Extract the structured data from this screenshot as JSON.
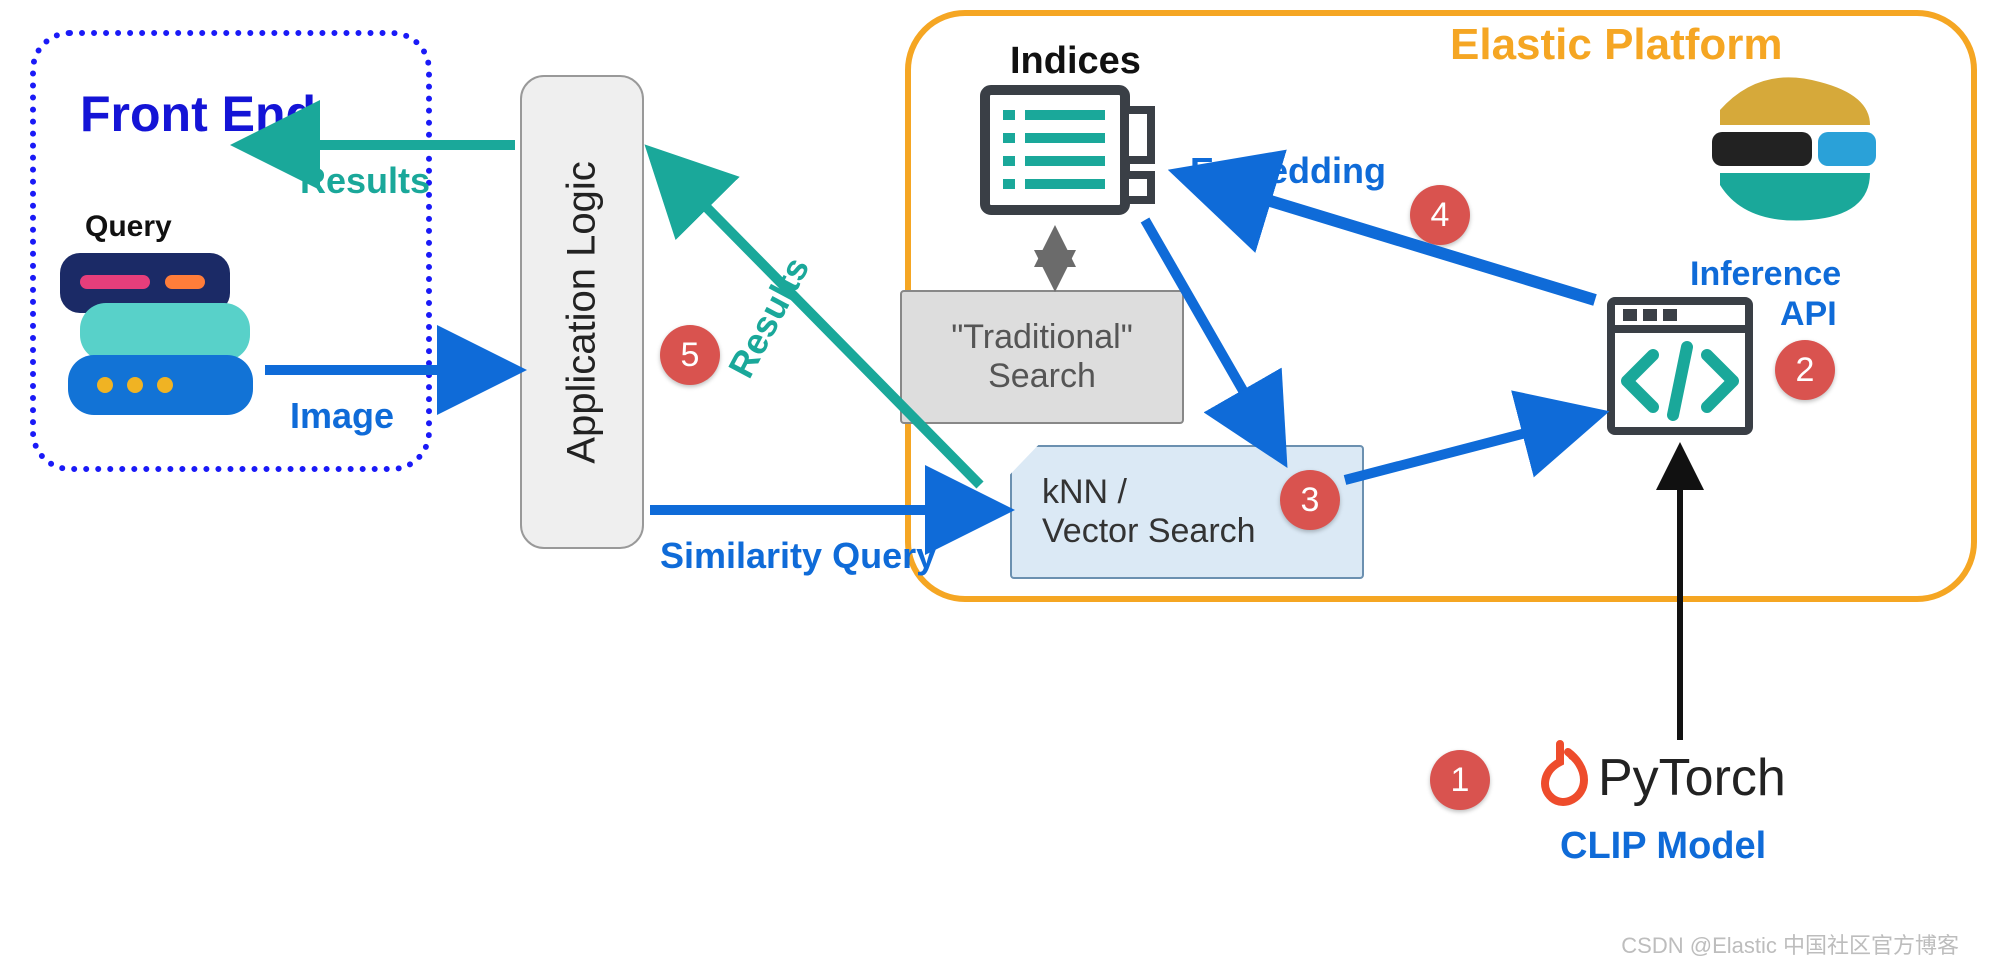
{
  "frontend": {
    "title": "Front End",
    "query_label": "Query"
  },
  "app_logic": {
    "label": "Application Logic"
  },
  "arrows": {
    "results_top": "Results",
    "image": "Image",
    "similarity_query": "Similarity Query",
    "results_diag": "Results",
    "embedding": "Embedding"
  },
  "elastic": {
    "title": "Elastic Platform",
    "indices_label": "Indices",
    "traditional_line1": "\"Traditional\"",
    "traditional_line2": "Search",
    "knn_line1": "kNN /",
    "knn_line2": "Vector Search",
    "inference_line1": "Inference",
    "inference_line2": "API"
  },
  "pytorch": {
    "name": "PyTorch",
    "clip_model": "CLIP Model"
  },
  "badges": {
    "b1": "1",
    "b2": "2",
    "b3": "3",
    "b4": "4",
    "b5": "5"
  },
  "watermark": "CSDN @Elastic 中国社区官方博客"
}
